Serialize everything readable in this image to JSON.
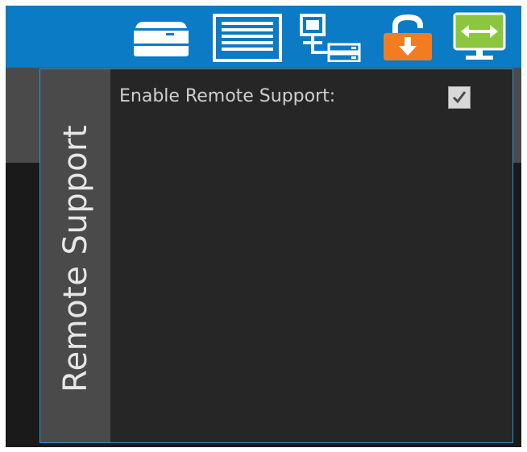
{
  "toolbar": {
    "icons": [
      {
        "name": "printer-icon",
        "color": "#ffffff"
      },
      {
        "name": "list-icon",
        "color": "#ffffff"
      },
      {
        "name": "network-icon",
        "color": "#ffffff"
      },
      {
        "name": "lock-download-icon",
        "color": "#f47c20"
      },
      {
        "name": "monitor-resize-icon",
        "color": "#8cc63f"
      }
    ],
    "bar_color": "#0a7bc4"
  },
  "panel": {
    "title": "Remote Support",
    "border_color": "#2a93d5",
    "options": [
      {
        "label": "Enable Remote Support:",
        "checked": true
      }
    ]
  }
}
